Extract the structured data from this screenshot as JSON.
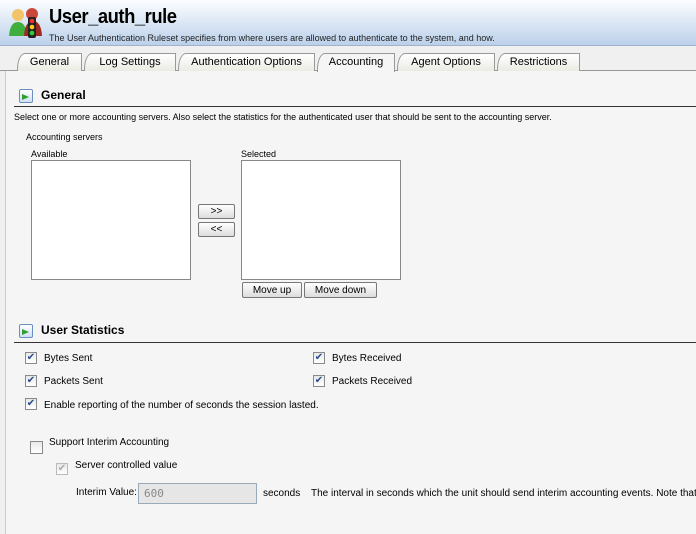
{
  "header": {
    "title": "User_auth_rule",
    "subtitle": "The User Authentication Ruleset specifies from where users are allowed to authenticate to the system, and how.",
    "icon": "users-traffic-light-icon"
  },
  "tabs": [
    {
      "label": "General"
    },
    {
      "label": "Log Settings"
    },
    {
      "label": "Authentication Options"
    },
    {
      "label": "Accounting",
      "active": true
    },
    {
      "label": "Agent Options"
    },
    {
      "label": "Restrictions"
    }
  ],
  "general": {
    "title": "General",
    "description": "Select one or more accounting servers. Also select the statistics for the authenticated user that should be sent to the accounting server.",
    "servers_label": "Accounting servers",
    "available_label": "Available",
    "selected_label": "Selected",
    "add_button": ">>",
    "remove_button": "<<",
    "move_up": "Move up",
    "move_down": "Move down",
    "available": [],
    "selected": []
  },
  "stats": {
    "title": "User Statistics",
    "bytes_sent": {
      "label": "Bytes Sent",
      "checked": true
    },
    "bytes_received": {
      "label": "Bytes Received",
      "checked": true
    },
    "packets_sent": {
      "label": "Packets Sent",
      "checked": true
    },
    "packets_received": {
      "label": "Packets Received",
      "checked": true
    },
    "session_seconds": {
      "label": "Enable reporting of the number of seconds the session lasted.",
      "checked": true
    },
    "interim": {
      "label": "Support Interim Accounting",
      "checked": false
    },
    "server_controlled": {
      "label": "Server controlled value",
      "checked": true,
      "disabled": true
    },
    "interim_value_label": "Interim Value:",
    "interim_value": "600",
    "unit": "seconds",
    "interim_help": "The interval in seconds which the unit should send interim accounting events. Note that this"
  }
}
